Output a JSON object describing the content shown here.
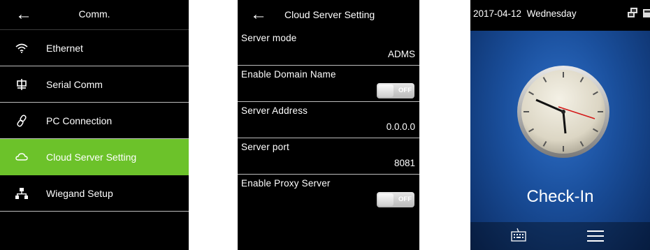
{
  "comm_screen": {
    "title": "Comm.",
    "items": [
      {
        "label": "Ethernet",
        "icon": "wifi-icon"
      },
      {
        "label": "Serial Comm",
        "icon": "serial-icon"
      },
      {
        "label": "PC Connection",
        "icon": "link-icon"
      },
      {
        "label": "Cloud Server Setting",
        "icon": "cloud-icon",
        "active": true
      },
      {
        "label": "Wiegand Setup",
        "icon": "network-icon"
      }
    ],
    "active_color": "#6cc22a"
  },
  "cloud_screen": {
    "title": "Cloud Server Setting",
    "fields": [
      {
        "label": "Server mode",
        "value": "ADMS"
      },
      {
        "label": "Enable Domain Name",
        "toggle": "OFF"
      },
      {
        "label": "Server Address",
        "value": "0.0.0.0"
      },
      {
        "label": "Server port",
        "value": "8081"
      },
      {
        "label": "Enable Proxy Server",
        "toggle": "OFF"
      }
    ]
  },
  "main_screen": {
    "date": "2017-04-12",
    "weekday": "Wednesday",
    "status": "Check-In"
  }
}
